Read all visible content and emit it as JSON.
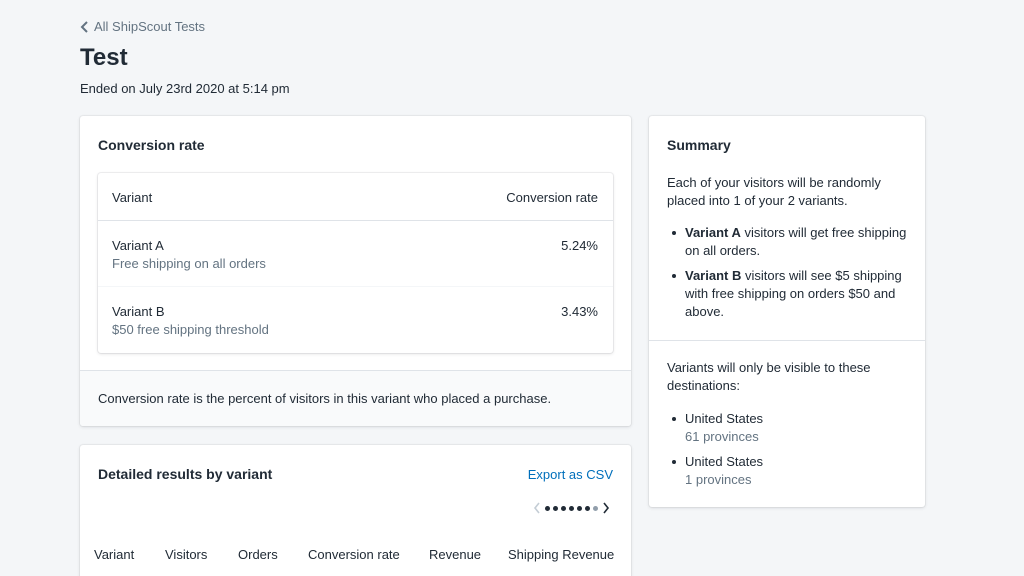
{
  "breadcrumb": {
    "label": "All ShipScout Tests"
  },
  "page": {
    "title": "Test",
    "subtitle": "Ended on July 23rd 2020 at 5:14 pm"
  },
  "conversion_card": {
    "title": "Conversion rate",
    "columns": [
      "Variant",
      "Conversion rate"
    ],
    "rows": [
      {
        "name": "Variant A",
        "description": "Free shipping on all orders",
        "rate": "5.24%"
      },
      {
        "name": "Variant B",
        "description": "$50 free shipping threshold",
        "rate": "3.43%"
      }
    ],
    "footer": "Conversion rate is the percent of visitors in this variant who placed a purchase."
  },
  "summary": {
    "title": "Summary",
    "intro": "Each of your visitors will be randomly placed into 1 of your 2 variants.",
    "variants": [
      {
        "bold": "Variant A",
        "text": " visitors will get free shipping on all orders."
      },
      {
        "bold": "Variant B",
        "text": " visitors will see $5 shipping with free shipping on orders $50 and above."
      }
    ],
    "destinations_intro": "Variants will only be visible to these destinations:",
    "destinations": [
      {
        "country": "United States",
        "detail": "61 provinces"
      },
      {
        "country": "United States",
        "detail": "1 provinces"
      }
    ]
  },
  "detail_card": {
    "title": "Detailed results by variant",
    "export_label": "Export as CSV",
    "pager": {
      "total_dots": 7,
      "active_dots": 6
    },
    "columns": [
      "Variant",
      "Visitors",
      "Orders",
      "Conversion rate",
      "Revenue",
      "Shipping Revenue"
    ]
  },
  "colors": {
    "link": "#006fbb",
    "text": "#212b36",
    "subdued": "#637381",
    "background": "#f4f6f8"
  },
  "icons": {
    "back": "chevron-left-icon",
    "prev": "chevron-left-icon",
    "next": "chevron-right-icon"
  }
}
